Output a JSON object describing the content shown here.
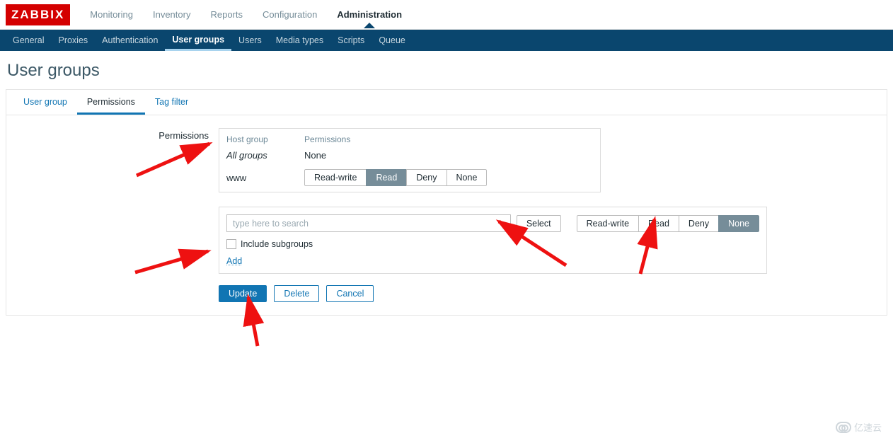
{
  "logo": "ZABBIX",
  "topnav": {
    "items": [
      "Monitoring",
      "Inventory",
      "Reports",
      "Configuration",
      "Administration"
    ],
    "active_index": 4
  },
  "subnav": {
    "items": [
      "General",
      "Proxies",
      "Authentication",
      "User groups",
      "Users",
      "Media types",
      "Scripts",
      "Queue"
    ],
    "active_index": 3
  },
  "page_title": "User groups",
  "tabs": {
    "items": [
      "User group",
      "Permissions",
      "Tag filter"
    ],
    "active_index": 1
  },
  "form": {
    "permissions_label": "Permissions",
    "table": {
      "header": {
        "host_group": "Host group",
        "permissions": "Permissions"
      },
      "rows": [
        {
          "group": "All groups",
          "italic": true,
          "perm_text": "None",
          "segments": null
        },
        {
          "group": "www",
          "italic": false,
          "perm_text": null,
          "segments": {
            "options": [
              "Read-write",
              "Read",
              "Deny",
              "None"
            ],
            "selected_index": 1
          }
        }
      ]
    },
    "add_block": {
      "search_placeholder": "type here to search",
      "select_label": "Select",
      "segments": {
        "options": [
          "Read-write",
          "Read",
          "Deny",
          "None"
        ],
        "selected_index": 3
      },
      "include_subgroups_label": "Include subgroups",
      "add_link": "Add"
    },
    "actions": {
      "update": "Update",
      "delete": "Delete",
      "cancel": "Cancel"
    }
  },
  "watermark": "亿速云"
}
